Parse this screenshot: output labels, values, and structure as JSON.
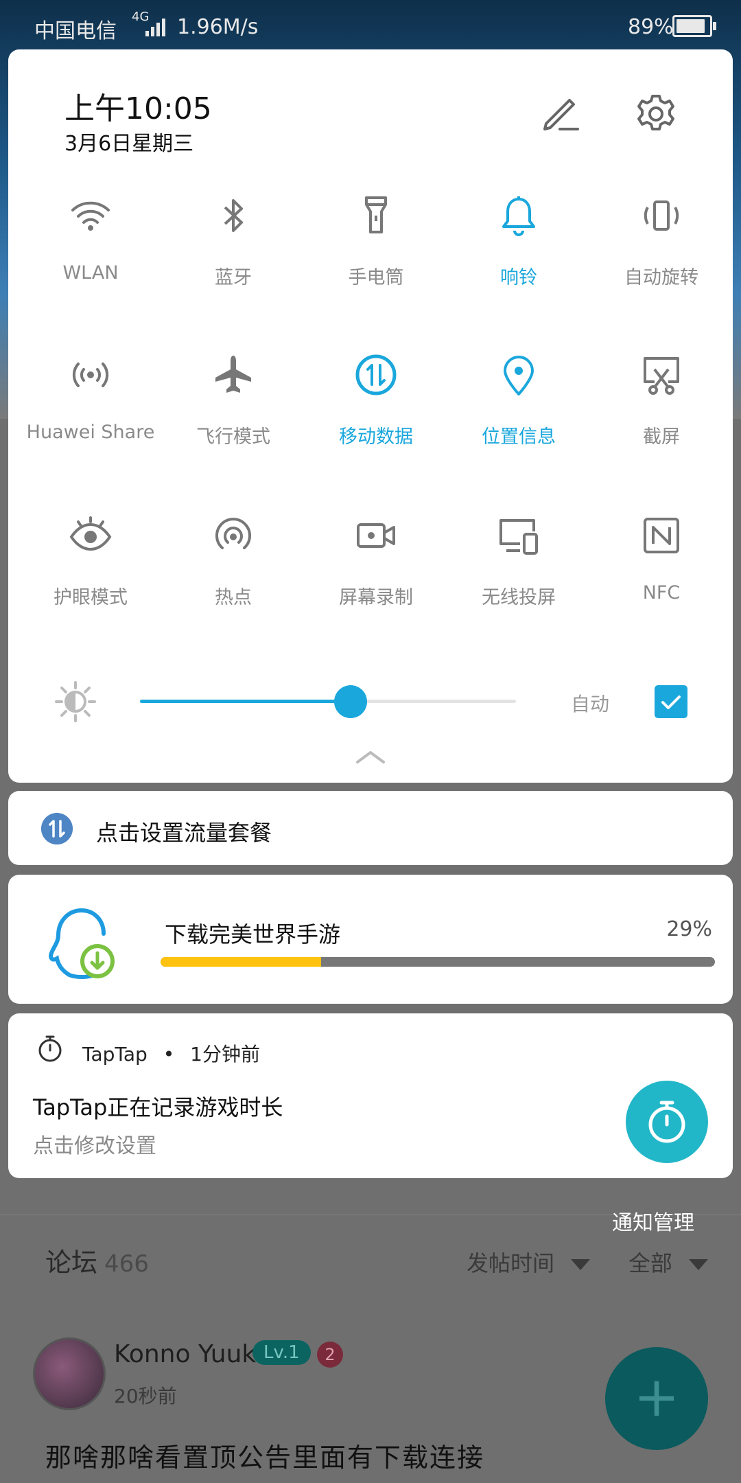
{
  "status_bar": {
    "carrier": "中国电信",
    "network": "4G",
    "speed": "1.96M/s",
    "battery_text": "89%",
    "battery_level": 0.89
  },
  "quick_settings": {
    "time": "上午10:05",
    "date": "3月6日星期三",
    "edit_icon": "pencil-icon",
    "settings_icon": "gear-icon",
    "accent_color": "#1aa7dc",
    "tiles": [
      {
        "label": "WLAN",
        "icon": "wifi-icon",
        "active": false
      },
      {
        "label": "蓝牙",
        "icon": "bluetooth-icon",
        "active": false
      },
      {
        "label": "手电筒",
        "icon": "flashlight-icon",
        "active": false
      },
      {
        "label": "响铃",
        "icon": "bell-icon",
        "active": true
      },
      {
        "label": "自动旋转",
        "icon": "rotate-icon",
        "active": false
      },
      {
        "label": "Huawei Share",
        "icon": "share-icon",
        "active": false
      },
      {
        "label": "飞行模式",
        "icon": "airplane-icon",
        "active": false
      },
      {
        "label": "移动数据",
        "icon": "mobile-data-icon",
        "active": true
      },
      {
        "label": "位置信息",
        "icon": "location-icon",
        "active": true
      },
      {
        "label": "截屏",
        "icon": "screenshot-icon",
        "active": false
      },
      {
        "label": "护眼模式",
        "icon": "eye-icon",
        "active": false
      },
      {
        "label": "热点",
        "icon": "hotspot-icon",
        "active": false
      },
      {
        "label": "屏幕录制",
        "icon": "screen-record-icon",
        "active": false
      },
      {
        "label": "无线投屏",
        "icon": "cast-icon",
        "active": false
      },
      {
        "label": "NFC",
        "icon": "nfc-icon",
        "active": false
      }
    ],
    "brightness": {
      "level": 0.56,
      "auto_label": "自动",
      "auto_checked": true
    }
  },
  "notifications": {
    "data_plan": {
      "icon": "mobile-data-icon",
      "text": "点击设置流量套餐"
    },
    "download": {
      "icon": "qq-download-icon",
      "title": "下载完美世界手游",
      "percent_text": "29%",
      "progress": 0.29
    },
    "taptap": {
      "icon": "stopwatch-icon",
      "app": "TapTap",
      "time": "1分钟前",
      "title": "TapTap正在记录游戏时长",
      "subtitle": "点击修改设置"
    }
  },
  "notification_manager": "通知管理",
  "background_app": {
    "forum_label": "论坛",
    "forum_count": "466",
    "sort_label": "发帖时间",
    "filter_label": "全部",
    "user": "Konno Yuuki",
    "user_level": "Lv.1",
    "user_badge": "2",
    "post_time": "20秒前",
    "post_title": "那啥那啥看置顶公告里面有下载连接"
  }
}
